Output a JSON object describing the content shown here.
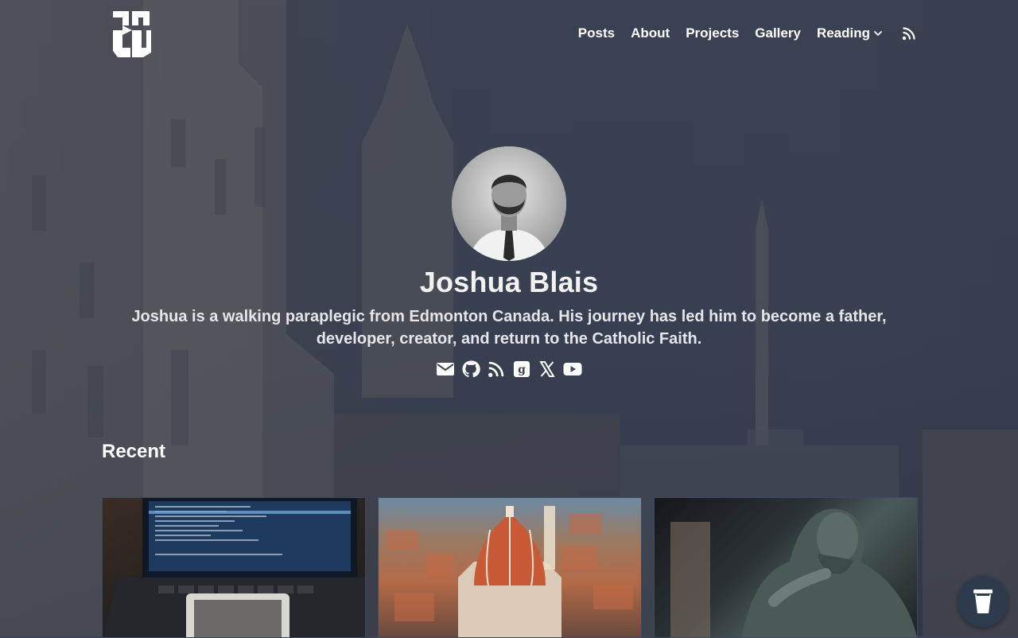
{
  "nav": {
    "items": [
      {
        "label": "Posts"
      },
      {
        "label": "About"
      },
      {
        "label": "Projects"
      },
      {
        "label": "Gallery"
      },
      {
        "label": "Reading",
        "has_dropdown": true
      }
    ],
    "rss_icon": "rss-icon"
  },
  "profile": {
    "name": "Joshua Blais",
    "bio": "Joshua is a walking paraplegic from Edmonton Canada. His journey has led him to become a father, developer, creator, and return to the Catholic Faith.",
    "socials": [
      "email-icon",
      "github-icon",
      "rss-icon",
      "goodreads-icon",
      "x-icon",
      "youtube-icon"
    ]
  },
  "recent": {
    "title": "Recent",
    "cards": [
      {
        "image": "laptop-terminal-photo"
      },
      {
        "image": "florence-cathedral-photo"
      },
      {
        "image": "thinking-statue-photo"
      }
    ]
  },
  "coffee_button": {
    "icon": "coffee-cup-icon"
  }
}
